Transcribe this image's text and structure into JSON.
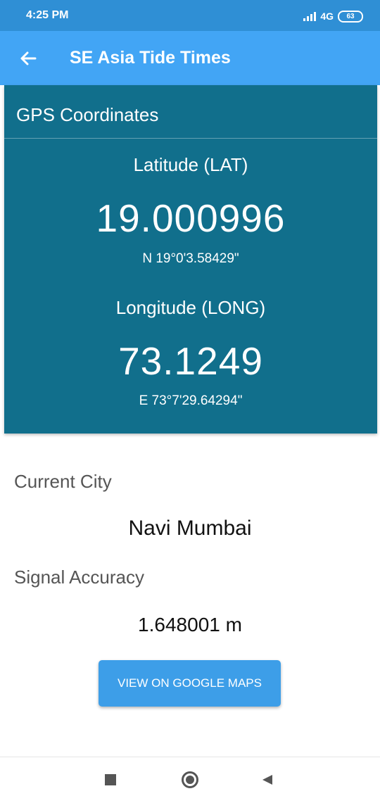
{
  "status_bar": {
    "time": "4:25 PM",
    "network": "4G",
    "battery": "63"
  },
  "app_bar": {
    "title": "SE Asia Tide Times",
    "back_icon": "arrow-left-icon"
  },
  "gps": {
    "header": "GPS Coordinates",
    "latitude": {
      "label": "Latitude (LAT)",
      "value": "19.000996",
      "dms": "N 19°0'3.58429\""
    },
    "longitude": {
      "label": "Longitude (LONG)",
      "value": "73.1249",
      "dms": "E 73°7'29.64294\""
    }
  },
  "info": {
    "city_label": "Current City",
    "city_value": "Navi Mumbai",
    "accuracy_label": "Signal Accuracy",
    "accuracy_value": "1.648001 m"
  },
  "actions": {
    "maps_button": "VIEW ON GOOGLE MAPS"
  },
  "colors": {
    "status_bar": "#2f8fd5",
    "app_bar": "#42a5f5",
    "card": "#116f8c",
    "button": "#3d9ee8"
  }
}
